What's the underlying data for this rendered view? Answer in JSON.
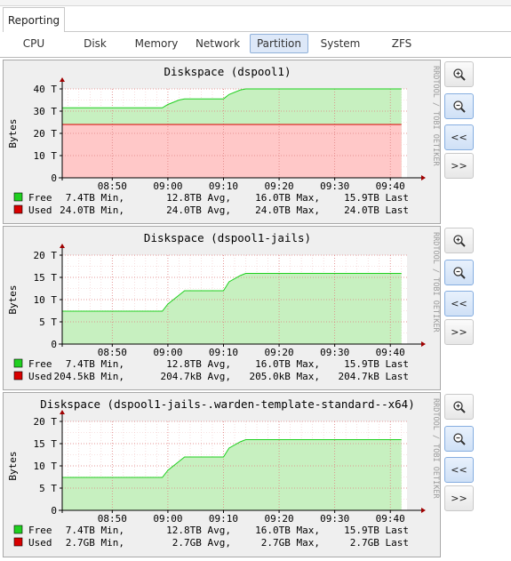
{
  "header": {
    "main_tab": "Reporting"
  },
  "subtabs": [
    {
      "label": "CPU"
    },
    {
      "label": "Disk"
    },
    {
      "label": "Memory"
    },
    {
      "label": "Network"
    },
    {
      "label": "Partition",
      "active": true
    },
    {
      "label": "System"
    },
    {
      "label": "ZFS"
    }
  ],
  "controls": {
    "zoom_in": "zoom-in-icon",
    "zoom_out": "zoom-out-icon",
    "back_label": "<<",
    "forward_label": ">>"
  },
  "watermark": "RRDTOOL / TOBI OETIKER",
  "colors": {
    "free_area": "#c7f0c0",
    "free_line": "#20d020",
    "used_area": "#ffc8c8",
    "used_line": "#d80000",
    "active_tab": "#dde8f8"
  },
  "chart_data": [
    {
      "type": "area",
      "title": "Diskspace (dspool1)",
      "ylabel": "Bytes",
      "y_ticks": [
        "40 T",
        "30 T",
        "20 T",
        "10 T",
        "0"
      ],
      "ylim": [
        0,
        40
      ],
      "x_ticks": [
        "08:50",
        "09:00",
        "09:10",
        "09:20",
        "09:30",
        "09:40"
      ],
      "x": [
        "08:41",
        "08:50",
        "08:59",
        "09:00",
        "09:02",
        "09:03",
        "09:10",
        "09:11",
        "09:13",
        "09:14",
        "09:20",
        "09:30",
        "09:40",
        "09:42"
      ],
      "series": [
        {
          "name": "Free",
          "unit": "T",
          "values": [
            31.5,
            31.5,
            31.5,
            33,
            35,
            35.5,
            35.5,
            37.5,
            39.5,
            40,
            40,
            40,
            40,
            40
          ]
        },
        {
          "name": "Used",
          "unit": "T",
          "values": [
            24,
            24,
            24,
            24,
            24,
            24,
            24,
            24,
            24,
            24,
            24,
            24,
            24,
            24
          ]
        }
      ],
      "stats": [
        {
          "name": "Free",
          "min": "7.4TB Min,",
          "avg": "12.8TB Avg,",
          "max": "16.0TB Max,",
          "last": "15.9TB Last"
        },
        {
          "name": "Used",
          "min": "24.0TB Min,",
          "avg": "24.0TB Avg,",
          "max": "24.0TB Max,",
          "last": "24.0TB Last"
        }
      ]
    },
    {
      "type": "area",
      "title": "Diskspace (dspool1-jails)",
      "ylabel": "Bytes",
      "y_ticks": [
        "20 T",
        "15 T",
        "10 T",
        "5 T",
        "0"
      ],
      "ylim": [
        0,
        20
      ],
      "x_ticks": [
        "08:50",
        "09:00",
        "09:10",
        "09:20",
        "09:30",
        "09:40"
      ],
      "x": [
        "08:41",
        "08:50",
        "08:59",
        "09:00",
        "09:02",
        "09:03",
        "09:10",
        "09:11",
        "09:13",
        "09:14",
        "09:20",
        "09:30",
        "09:40",
        "09:42"
      ],
      "series": [
        {
          "name": "Free",
          "unit": "T",
          "values": [
            7.4,
            7.4,
            7.4,
            9,
            11,
            12,
            12,
            14,
            15.4,
            15.9,
            15.9,
            15.9,
            15.9,
            15.9
          ]
        },
        {
          "name": "Used",
          "unit": "T",
          "values": [
            0,
            0,
            0,
            0,
            0,
            0,
            0,
            0,
            0,
            0,
            0,
            0,
            0,
            0
          ]
        }
      ],
      "stats": [
        {
          "name": "Free",
          "min": "7.4TB Min,",
          "avg": "12.8TB Avg,",
          "max": "16.0TB Max,",
          "last": "15.9TB Last"
        },
        {
          "name": "Used",
          "min": "204.5kB Min,",
          "avg": "204.7kB Avg,",
          "max": "205.0kB Max,",
          "last": "204.7kB Last"
        }
      ]
    },
    {
      "type": "area",
      "title": "Diskspace (dspool1-jails-.warden-template-standard--x64)",
      "ylabel": "Bytes",
      "y_ticks": [
        "20 T",
        "15 T",
        "10 T",
        "5 T",
        "0"
      ],
      "ylim": [
        0,
        20
      ],
      "x_ticks": [
        "08:50",
        "09:00",
        "09:10",
        "09:20",
        "09:30",
        "09:40"
      ],
      "x": [
        "08:41",
        "08:50",
        "08:59",
        "09:00",
        "09:02",
        "09:03",
        "09:10",
        "09:11",
        "09:13",
        "09:14",
        "09:20",
        "09:30",
        "09:40",
        "09:42"
      ],
      "series": [
        {
          "name": "Free",
          "unit": "T",
          "values": [
            7.4,
            7.4,
            7.4,
            9,
            11,
            12,
            12,
            14,
            15.4,
            15.9,
            15.9,
            15.9,
            15.9,
            15.9
          ]
        },
        {
          "name": "Used",
          "unit": "T",
          "values": [
            0,
            0,
            0,
            0,
            0,
            0,
            0,
            0,
            0,
            0,
            0,
            0,
            0,
            0
          ]
        }
      ],
      "stats": [
        {
          "name": "Free",
          "min": "7.4TB Min,",
          "avg": "12.8TB Avg,",
          "max": "16.0TB Max,",
          "last": "15.9TB Last"
        },
        {
          "name": "Used",
          "min": "2.7GB Min,",
          "avg": "2.7GB Avg,",
          "max": "2.7GB Max,",
          "last": "2.7GB Last"
        }
      ]
    }
  ]
}
